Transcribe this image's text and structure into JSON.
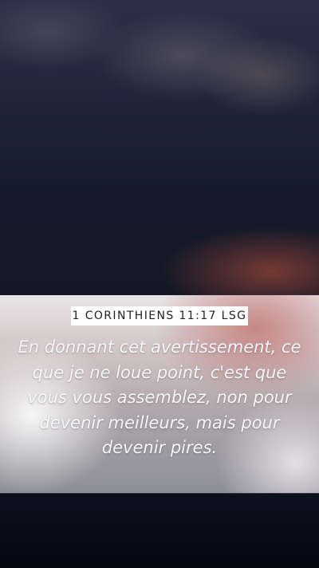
{
  "wallpaper": {
    "reference": "1 CORINTHIENS 11:17 LSG",
    "verse_text": "En donnant cet avertissement, ce que je ne loue point, c'est que vous vous assemblez, non pour devenir meilleurs, mais pour devenir pires.",
    "colors": {
      "sky_top": "#2c3046",
      "sky_bottom": "#141726",
      "sunset_glow": "#964637",
      "band_light": "#e8e4e6",
      "footer": "#070814"
    }
  }
}
